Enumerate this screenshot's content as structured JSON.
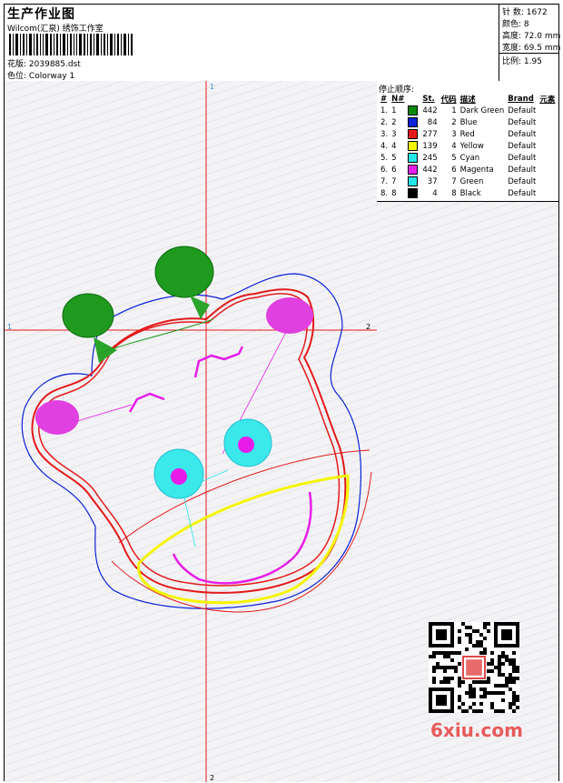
{
  "header": {
    "title": "生产作业图",
    "studio": "Wilcom(汇泉) 绣饰工作室",
    "design_label": "花版:",
    "design_value": "2039885.dst",
    "colorway_label": "色位:",
    "colorway_value": "Colorway 1"
  },
  "summary": {
    "stitches_label": "针 数:",
    "stitches_value": "1672",
    "colors_label": "颜色:",
    "colors_value": "8",
    "height_label": "高度:",
    "height_value": "72.0 mm",
    "width_label": "宽度:",
    "width_value": "69.5 mm",
    "ratio_label": "比例:",
    "ratio_value": "1.95"
  },
  "axes": {
    "top": "1",
    "bottom": "2",
    "left": "1",
    "right": "2"
  },
  "stop_sequence": {
    "title": "停止顺序:",
    "columns": [
      "#",
      "N#",
      "St.",
      "代码",
      "描述",
      "Brand",
      "元素"
    ],
    "rows": [
      {
        "idx": "1.",
        "n": "1",
        "color": "#0a8a0a",
        "st": "442",
        "code": "1",
        "desc": "Dark Green",
        "brand": "Default"
      },
      {
        "idx": "2.",
        "n": "2",
        "color": "#0a22d8",
        "st": "84",
        "code": "2",
        "desc": "Blue",
        "brand": "Default"
      },
      {
        "idx": "3.",
        "n": "3",
        "color": "#e41a1a",
        "st": "277",
        "code": "3",
        "desc": "Red",
        "brand": "Default"
      },
      {
        "idx": "4.",
        "n": "4",
        "color": "#f5f500",
        "st": "139",
        "code": "4",
        "desc": "Yellow",
        "brand": "Default"
      },
      {
        "idx": "5.",
        "n": "5",
        "color": "#22e6e6",
        "st": "245",
        "code": "5",
        "desc": "Cyan",
        "brand": "Default"
      },
      {
        "idx": "6.",
        "n": "6",
        "color": "#e81ce8",
        "st": "442",
        "code": "6",
        "desc": "Magenta",
        "brand": "Default"
      },
      {
        "idx": "7.",
        "n": "7",
        "color": "#22e6e6",
        "st": "37",
        "code": "7",
        "desc": "Green",
        "brand": "Default"
      },
      {
        "idx": "8.",
        "n": "8",
        "color": "#000000",
        "st": "4",
        "code": "8",
        "desc": "Black",
        "brand": "Default"
      }
    ]
  },
  "watermark": {
    "brand": "6xiu.com",
    "seal": "刺绣图"
  }
}
